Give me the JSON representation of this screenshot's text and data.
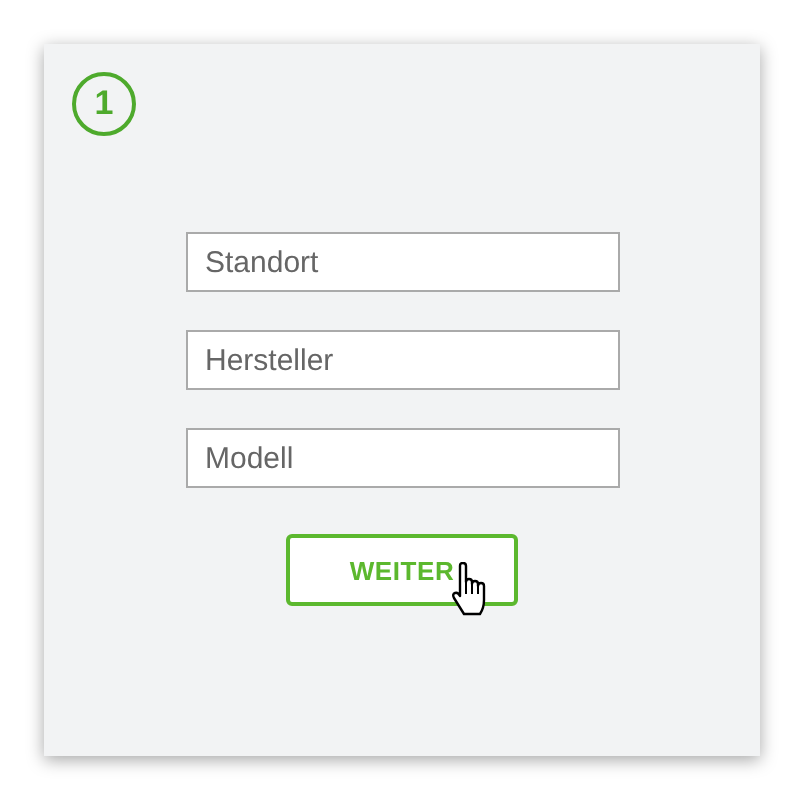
{
  "step": {
    "number": "1"
  },
  "fields": [
    {
      "placeholder": "Standort"
    },
    {
      "placeholder": "Hersteller"
    },
    {
      "placeholder": "Modell"
    }
  ],
  "button": {
    "label": "WEITER"
  }
}
